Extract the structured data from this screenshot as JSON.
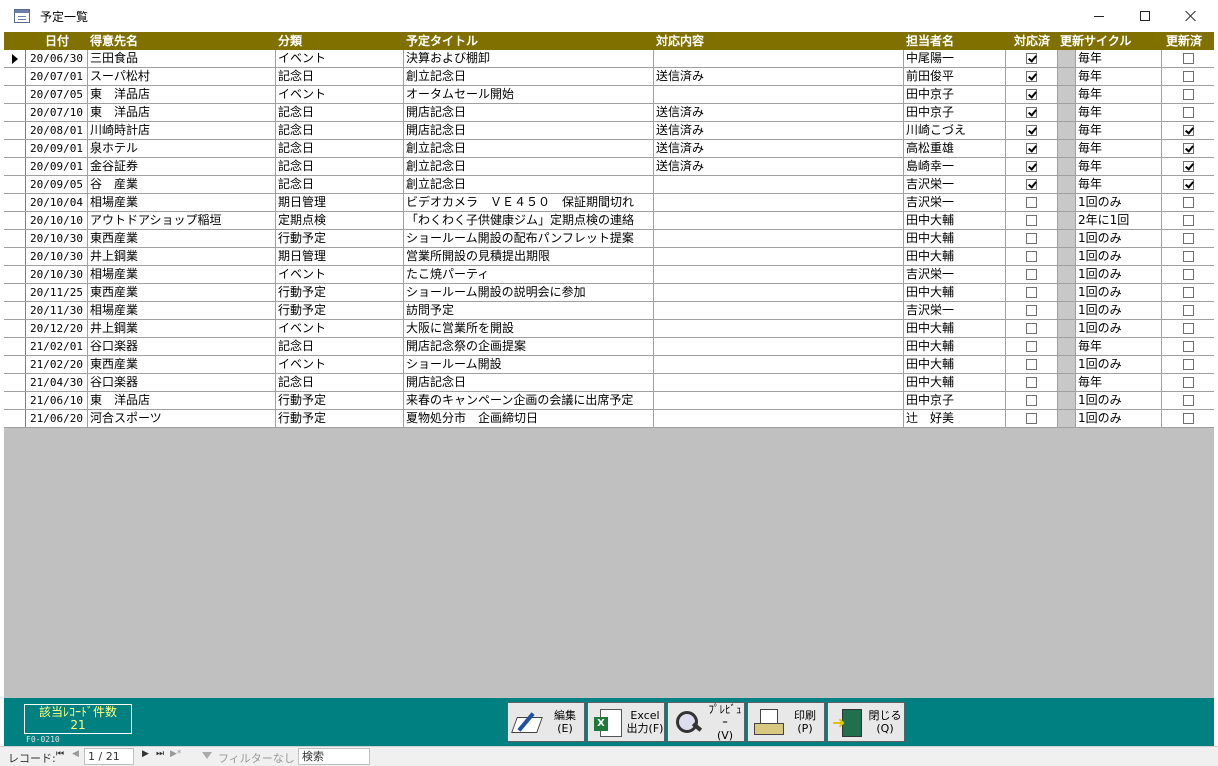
{
  "window": {
    "title": "予定一覧"
  },
  "columns": {
    "date": "日付",
    "customer": "得意先名",
    "category": "分類",
    "title": "予定タイトル",
    "response": "対応内容",
    "staff": "担当者名",
    "done": "対応済",
    "cycle": "更新サイクル",
    "updated": "更新済"
  },
  "rows": [
    {
      "date": "20/06/30",
      "customer": "三田食品",
      "category": "イベント",
      "title": "決算および棚卸",
      "response": "",
      "staff": "中尾陽一",
      "done": true,
      "cycle": "毎年",
      "updated": false
    },
    {
      "date": "20/07/01",
      "customer": "スーパ松村",
      "category": "記念日",
      "title": "創立記念日",
      "response": "送信済み",
      "staff": "前田俊平",
      "done": true,
      "cycle": "毎年",
      "updated": false
    },
    {
      "date": "20/07/05",
      "customer": "東　洋品店",
      "category": "イベント",
      "title": "オータムセール開始",
      "response": "",
      "staff": "田中京子",
      "done": true,
      "cycle": "毎年",
      "updated": false
    },
    {
      "date": "20/07/10",
      "customer": "東　洋品店",
      "category": "記念日",
      "title": "開店記念日",
      "response": "送信済み",
      "staff": "田中京子",
      "done": true,
      "cycle": "毎年",
      "updated": false
    },
    {
      "date": "20/08/01",
      "customer": "川崎時計店",
      "category": "記念日",
      "title": "開店記念日",
      "response": "送信済み",
      "staff": "川崎こづえ",
      "done": true,
      "cycle": "毎年",
      "updated": true
    },
    {
      "date": "20/09/01",
      "customer": "泉ホテル",
      "category": "記念日",
      "title": "創立記念日",
      "response": "送信済み",
      "staff": "高松重雄",
      "done": true,
      "cycle": "毎年",
      "updated": true
    },
    {
      "date": "20/09/01",
      "customer": "金谷証券",
      "category": "記念日",
      "title": "創立記念日",
      "response": "送信済み",
      "staff": "島崎幸一",
      "done": true,
      "cycle": "毎年",
      "updated": true
    },
    {
      "date": "20/09/05",
      "customer": "谷　産業",
      "category": "記念日",
      "title": "創立記念日",
      "response": "",
      "staff": "吉沢栄一",
      "done": true,
      "cycle": "毎年",
      "updated": true
    },
    {
      "date": "20/10/04",
      "customer": "相場産業",
      "category": "期日管理",
      "title": "ビデオカメラ　ＶＥ４５０　保証期間切れ",
      "response": "",
      "staff": "吉沢栄一",
      "done": false,
      "cycle": "1回のみ",
      "updated": false
    },
    {
      "date": "20/10/10",
      "customer": "アウトドアショップ稲垣",
      "category": "定期点検",
      "title": "「わくわく子供健康ジム」定期点検の連絡",
      "response": "",
      "staff": "田中大輔",
      "done": false,
      "cycle": "2年に1回",
      "updated": false
    },
    {
      "date": "20/10/30",
      "customer": "東西産業",
      "category": "行動予定",
      "title": "ショールーム開設の配布パンフレット提案",
      "response": "",
      "staff": "田中大輔",
      "done": false,
      "cycle": "1回のみ",
      "updated": false
    },
    {
      "date": "20/10/30",
      "customer": "井上鋼業",
      "category": "期日管理",
      "title": "営業所開設の見積提出期限",
      "response": "",
      "staff": "田中大輔",
      "done": false,
      "cycle": "1回のみ",
      "updated": false
    },
    {
      "date": "20/10/30",
      "customer": "相場産業",
      "category": "イベント",
      "title": "たこ焼パーティ",
      "response": "",
      "staff": "吉沢栄一",
      "done": false,
      "cycle": "1回のみ",
      "updated": false
    },
    {
      "date": "20/11/25",
      "customer": "東西産業",
      "category": "行動予定",
      "title": "ショールーム開設の説明会に参加",
      "response": "",
      "staff": "田中大輔",
      "done": false,
      "cycle": "1回のみ",
      "updated": false
    },
    {
      "date": "20/11/30",
      "customer": "相場産業",
      "category": "行動予定",
      "title": "訪問予定",
      "response": "",
      "staff": "吉沢栄一",
      "done": false,
      "cycle": "1回のみ",
      "updated": false
    },
    {
      "date": "20/12/20",
      "customer": "井上鋼業",
      "category": "イベント",
      "title": "大阪に営業所を開設",
      "response": "",
      "staff": "田中大輔",
      "done": false,
      "cycle": "1回のみ",
      "updated": false
    },
    {
      "date": "21/02/01",
      "customer": "谷口楽器",
      "category": "記念日",
      "title": "開店記念祭の企画提案",
      "response": "",
      "staff": "田中大輔",
      "done": false,
      "cycle": "毎年",
      "updated": false
    },
    {
      "date": "21/02/20",
      "customer": "東西産業",
      "category": "イベント",
      "title": "ショールーム開設",
      "response": "",
      "staff": "田中大輔",
      "done": false,
      "cycle": "1回のみ",
      "updated": false
    },
    {
      "date": "21/04/30",
      "customer": "谷口楽器",
      "category": "記念日",
      "title": "開店記念日",
      "response": "",
      "staff": "田中大輔",
      "done": false,
      "cycle": "毎年",
      "updated": false
    },
    {
      "date": "21/06/10",
      "customer": "東　洋品店",
      "category": "行動予定",
      "title": "来春のキャンペーン企画の会議に出席予定",
      "response": "",
      "staff": "田中京子",
      "done": false,
      "cycle": "1回のみ",
      "updated": false
    },
    {
      "date": "21/06/20",
      "customer": "河合スポーツ",
      "category": "行動予定",
      "title": "夏物処分市　企画締切日",
      "response": "",
      "staff": "辻　好美",
      "done": false,
      "cycle": "1回のみ",
      "updated": false
    }
  ],
  "footer": {
    "count_label": "該当ﾚｺｰﾄﾞ件数",
    "count_value": "21",
    "form_id": "F0-0210",
    "buttons": {
      "edit": {
        "line1": "編集",
        "line2": "(E)"
      },
      "excel": {
        "line1": "Excel",
        "line2": "出力(F)"
      },
      "preview": {
        "line1": "ﾌﾟﾚﾋﾞｭｰ",
        "line2": "(V)"
      },
      "print": {
        "line1": "印刷",
        "line2": "(P)"
      },
      "close": {
        "line1": "閉じる",
        "line2": "(Q)"
      }
    }
  },
  "navigation": {
    "record_label": "レコード:",
    "first": "⏮",
    "prev": "◀",
    "position": "1 / 21",
    "next": "▶",
    "last": "⏭",
    "new": "▶*",
    "filter_label": "フィルターなし",
    "search_label": "検索"
  },
  "colors": {
    "header_bg": "#807000",
    "footer_bg": "#008080",
    "count_text": "#ffff80"
  },
  "icons": {
    "edit": "edit-pencil-icon",
    "excel": "excel-icon",
    "preview": "magnifier-icon",
    "print": "printer-icon",
    "close": "exit-door-icon"
  }
}
